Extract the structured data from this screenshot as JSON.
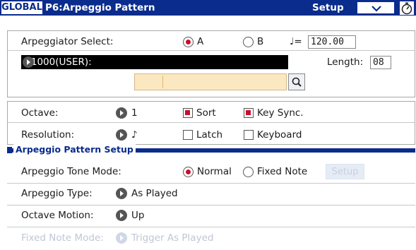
{
  "header": {
    "mode_tab": "GLOBAL",
    "page_title": "P6:Arpeggio Pattern",
    "setup_label": "Setup",
    "menu_icon": "chevron-down-icon",
    "timer_icon": "stopwatch-icon"
  },
  "pattern": {
    "selector_label": "Arpeggiator Select:",
    "option_a": "A",
    "option_b": "B",
    "selected": "A",
    "tempo_symbol": "♩=",
    "tempo": "120.00",
    "pattern_name": "U1000(USER):",
    "length_label": "Length:",
    "length": "08",
    "search_icon": "magnifier-icon"
  },
  "settings": {
    "octave_label": "Octave:",
    "octave_value": "1",
    "sort_label": "Sort",
    "sort_checked": true,
    "key_sync_label": "Key Sync.",
    "key_sync_checked": true,
    "resolution_label": "Resolution:",
    "resolution_value": "♪",
    "latch_label": "Latch",
    "latch_checked": false,
    "keyboard_label": "Keyboard",
    "keyboard_checked": false
  },
  "setup_section": {
    "title": "Arpeggio Pattern Setup",
    "tone_mode_label": "Arpeggio Tone Mode:",
    "tone_mode_normal": "Normal",
    "tone_mode_fixed": "Fixed Note",
    "tone_mode_selected": "Normal",
    "setup_button": "Setup",
    "type_label": "Arpeggio Type:",
    "type_value": "As Played",
    "octave_motion_label": "Octave Motion:",
    "octave_motion_value": "Up",
    "fixed_note_mode_label": "Fixed Note Mode:",
    "fixed_note_mode_value": "Trigger As Played"
  },
  "colors": {
    "header_blue": "#0a2c8c",
    "selected_red": "#c8102e",
    "field_yellow": "#fbe8c0"
  }
}
